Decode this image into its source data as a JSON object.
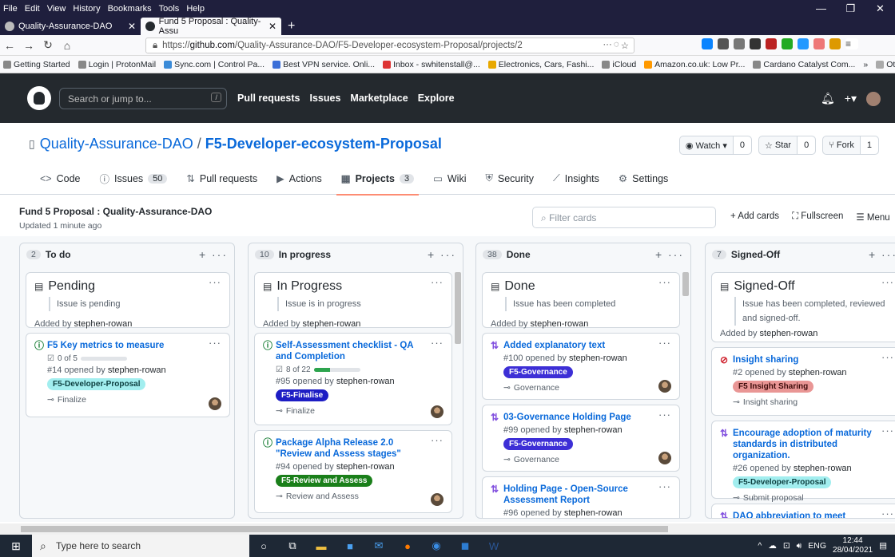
{
  "menu": [
    "File",
    "Edit",
    "View",
    "History",
    "Bookmarks",
    "Tools",
    "Help"
  ],
  "window_controls": [
    "—",
    "❐",
    "✕"
  ],
  "browser_tabs": [
    {
      "title": "Quality-Assurance-DAO",
      "active": false
    },
    {
      "title": "Fund 5 Proposal : Quality-Assu",
      "active": true
    }
  ],
  "new_tab": "+",
  "url": {
    "host": "github.com",
    "prefix": "https://",
    "path": "/Quality-Assurance-DAO/F5-Developer-ecosystem-Proposal/projects/2"
  },
  "bookmarks": [
    "Getting Started",
    "Login | ProtonMail",
    "Sync.com | Control Pa...",
    "Best VPN service. Onli...",
    "Inbox - swhitenstall@...",
    "Electronics, Cars, Fashi...",
    "iCloud",
    "Amazon.co.uk: Low Pr...",
    "Cardano Catalyst Com...",
    "»",
    "Other Bookmarks"
  ],
  "gh": {
    "search_placeholder": "Search or jump to...",
    "slash": "/",
    "nav": [
      "Pull requests",
      "Issues",
      "Marketplace",
      "Explore"
    ]
  },
  "repo": {
    "owner": "Quality-Assurance-DAO",
    "sep": "/",
    "name": "F5-Developer-ecosystem-Proposal",
    "watch": {
      "label": "Watch ▾",
      "count": "0"
    },
    "star": {
      "label": "Star",
      "count": "0"
    },
    "fork": {
      "label": "Fork",
      "count": "1"
    }
  },
  "repo_tabs": [
    {
      "icon": "<>",
      "label": "Code",
      "count": ""
    },
    {
      "icon": "ⓘ",
      "label": "Issues",
      "count": "50"
    },
    {
      "icon": "⇅",
      "label": "Pull requests",
      "count": ""
    },
    {
      "icon": "▶",
      "label": "Actions",
      "count": ""
    },
    {
      "icon": "▦",
      "label": "Projects",
      "count": "3"
    },
    {
      "icon": "▭",
      "label": "Wiki",
      "count": ""
    },
    {
      "icon": "⛨",
      "label": "Security",
      "count": ""
    },
    {
      "icon": "⟋",
      "label": "Insights",
      "count": ""
    },
    {
      "icon": "⚙",
      "label": "Settings",
      "count": ""
    }
  ],
  "project": {
    "name": "Fund 5 Proposal : Quality-Assurance-DAO",
    "updated": "Updated 1 minute ago",
    "filter_placeholder": "Filter cards",
    "add_cards": "+ Add cards",
    "fullscreen": "⛶ Fullscreen",
    "menu": "☰ Menu"
  },
  "columns": [
    {
      "count": "2",
      "name": "To do",
      "note": {
        "title": "Pending",
        "body": "Issue is pending",
        "added_prefix": "Added by",
        "added_by": "stephen-rowan"
      },
      "cards": [
        {
          "type": "issue",
          "title": "F5 Key metrics to measure",
          "progress": "0 of 5",
          "progress_frac": 0,
          "num": "#14",
          "opened": "opened by",
          "user": "stephen-rowan",
          "label": "F5-Developer-Proposal",
          "label_bg": "#a2eeef",
          "label_fg": "#0c3e3f",
          "project": "Finalize"
        }
      ]
    },
    {
      "count": "10",
      "name": "In progress",
      "note": {
        "title": "In Progress",
        "body": "Issue is in progress",
        "added_prefix": "Added by",
        "added_by": "stephen-rowan"
      },
      "cards": [
        {
          "type": "issue",
          "title": "Self-Assessment checklist - QA and Completion",
          "progress": "8 of 22",
          "progress_frac": 0.36,
          "num": "#95",
          "opened": "opened by",
          "user": "stephen-rowan",
          "label": "F5-Finalise",
          "label_bg": "#1d1dc4",
          "label_fg": "#ffffff",
          "project": "Finalize"
        },
        {
          "type": "issue",
          "title": "Package Alpha Release 2.0 \"Review and Assess stages\"",
          "progress": "",
          "num": "#94",
          "opened": "opened by",
          "user": "stephen-rowan",
          "label": "F5-Review and Assess",
          "label_bg": "#1a7f1a",
          "label_fg": "#ffffff",
          "project": "Review and Assess"
        }
      ]
    },
    {
      "count": "38",
      "name": "Done",
      "note": {
        "title": "Done",
        "body": "Issue has been completed",
        "added_prefix": "Added by",
        "added_by": "stephen-rowan"
      },
      "cards": [
        {
          "type": "pr",
          "title": "Added explanatory text",
          "num": "#100",
          "opened": "opened by",
          "user": "stephen-rowan",
          "label": "F5-Governance",
          "label_bg": "#3d2fd6",
          "label_fg": "#ffffff",
          "project": "Governance"
        },
        {
          "type": "pr",
          "title": "03-Governance Holding Page",
          "num": "#99",
          "opened": "opened by",
          "user": "stephen-rowan",
          "label": "F5-Governance",
          "label_bg": "#3d2fd6",
          "label_fg": "#ffffff",
          "project": "Governance"
        },
        {
          "type": "pr",
          "title": "Holding Page - Open-Source Assessment Report",
          "num": "#96",
          "opened": "opened by",
          "user": "stephen-rowan",
          "label": "",
          "project": ""
        }
      ]
    },
    {
      "count": "7",
      "name": "Signed-Off",
      "note": {
        "title": "Signed-Off",
        "body": "Issue has been completed, reviewed and signed-off.",
        "added_prefix": "Added by",
        "added_by": "stephen-rowan"
      },
      "cards": [
        {
          "type": "closed",
          "title": "Insight sharing",
          "num": "#2",
          "opened": "opened by",
          "user": "stephen-rowan",
          "label": "F5 Insight Sharing",
          "label_bg": "#e99695",
          "label_fg": "#3f0d0c",
          "project": "Insight sharing"
        },
        {
          "type": "pr",
          "title": "Encourage adoption of maturity standards in distributed organization.",
          "num": "#26",
          "opened": "opened by",
          "user": "stephen-rowan",
          "label": "F5-Developer-Proposal",
          "label_bg": "#a2eeef",
          "label_fg": "#0c3e3f",
          "project": "Submit proposal"
        },
        {
          "type": "pr",
          "title": "DAO abbreviation to meet wordcount",
          "num": "",
          "opened": "",
          "user": "",
          "label": "",
          "project": ""
        }
      ]
    }
  ],
  "taskbar": {
    "search": "Type here to search",
    "lang": "ENG",
    "time": "12:44",
    "date": "28/04/2021"
  }
}
